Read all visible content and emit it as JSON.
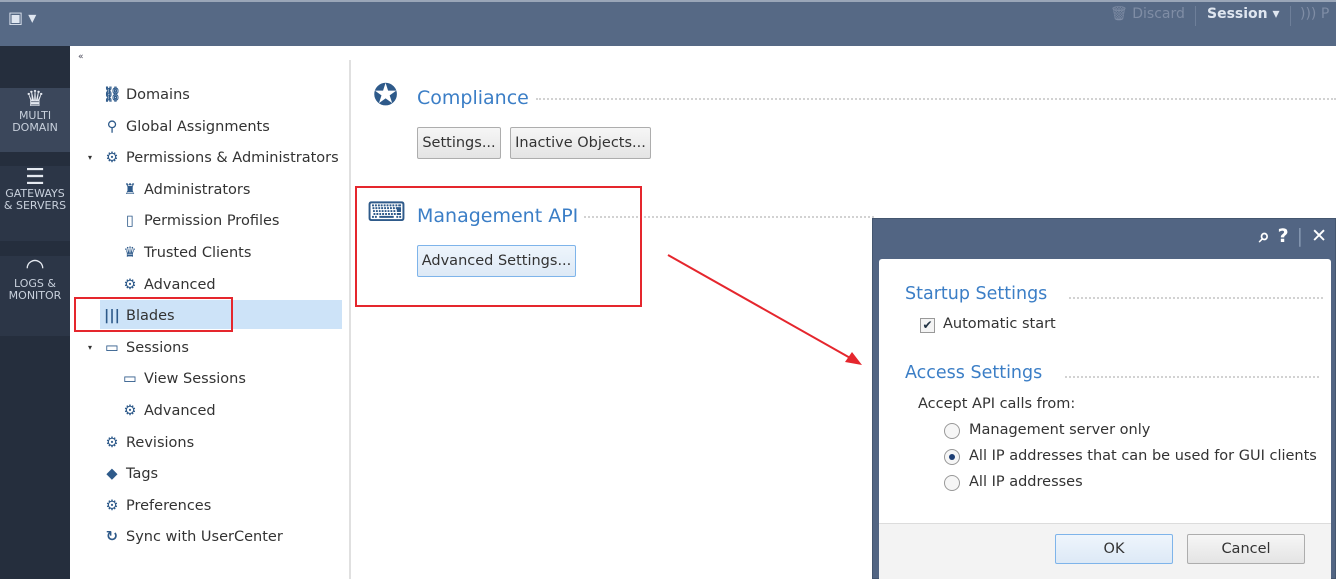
{
  "topbar": {
    "discard_label": "Discard",
    "session_label": "Session",
    "publish_partial": "P"
  },
  "leftnav": [
    {
      "label1": "MULTI",
      "label2": "DOMAIN",
      "icon": "crown-icon"
    },
    {
      "label1": "GATEWAYS",
      "label2": "& SERVERS",
      "icon": "servers-icon"
    },
    {
      "label1": "LOGS &",
      "label2": "MONITOR",
      "icon": "gauge-icon"
    }
  ],
  "tree": {
    "collapse_icon": "«",
    "items": [
      {
        "label": "Domains",
        "icon": "domains-icon"
      },
      {
        "label": "Global Assignments",
        "icon": "global-assignments-icon"
      },
      {
        "label": "Permissions & Administrators",
        "icon": "gear-icon",
        "expanded": true
      },
      {
        "label": "Administrators",
        "icon": "administrator-icon"
      },
      {
        "label": "Permission Profiles",
        "icon": "permission-profile-icon"
      },
      {
        "label": "Trusted Clients",
        "icon": "trusted-clients-icon"
      },
      {
        "label": "Advanced",
        "icon": "gear-icon"
      },
      {
        "label": "Blades",
        "icon": "blades-icon",
        "selected": true
      },
      {
        "label": "Sessions",
        "icon": "sessions-icon",
        "expanded": true
      },
      {
        "label": "View Sessions",
        "icon": "view-sessions-icon"
      },
      {
        "label": "Advanced",
        "icon": "gear-icon"
      },
      {
        "label": "Revisions",
        "icon": "gear-icon"
      },
      {
        "label": "Tags",
        "icon": "tag-icon"
      },
      {
        "label": "Preferences",
        "icon": "gear-icon"
      },
      {
        "label": "Sync with UserCenter",
        "icon": "sync-icon"
      }
    ]
  },
  "main": {
    "compliance": {
      "title": "Compliance",
      "settings_button": "Settings...",
      "inactive_button": "Inactive Objects..."
    },
    "mgmt_api": {
      "title": "Management API",
      "advanced_button": "Advanced Settings..."
    }
  },
  "dialog": {
    "startup_title": "Startup Settings",
    "automatic_start": "Automatic start",
    "automatic_start_checked": true,
    "access_title": "Access Settings",
    "accept_label": "Accept API calls from:",
    "options": [
      "Management server only",
      "All IP addresses that can be used for GUI clients",
      "All IP addresses"
    ],
    "selected_option": 1,
    "ok": "OK",
    "cancel": "Cancel"
  },
  "colors": {
    "accent": "#3b7ec6",
    "highlight": "#e5262d",
    "titlebar": "#566985"
  }
}
